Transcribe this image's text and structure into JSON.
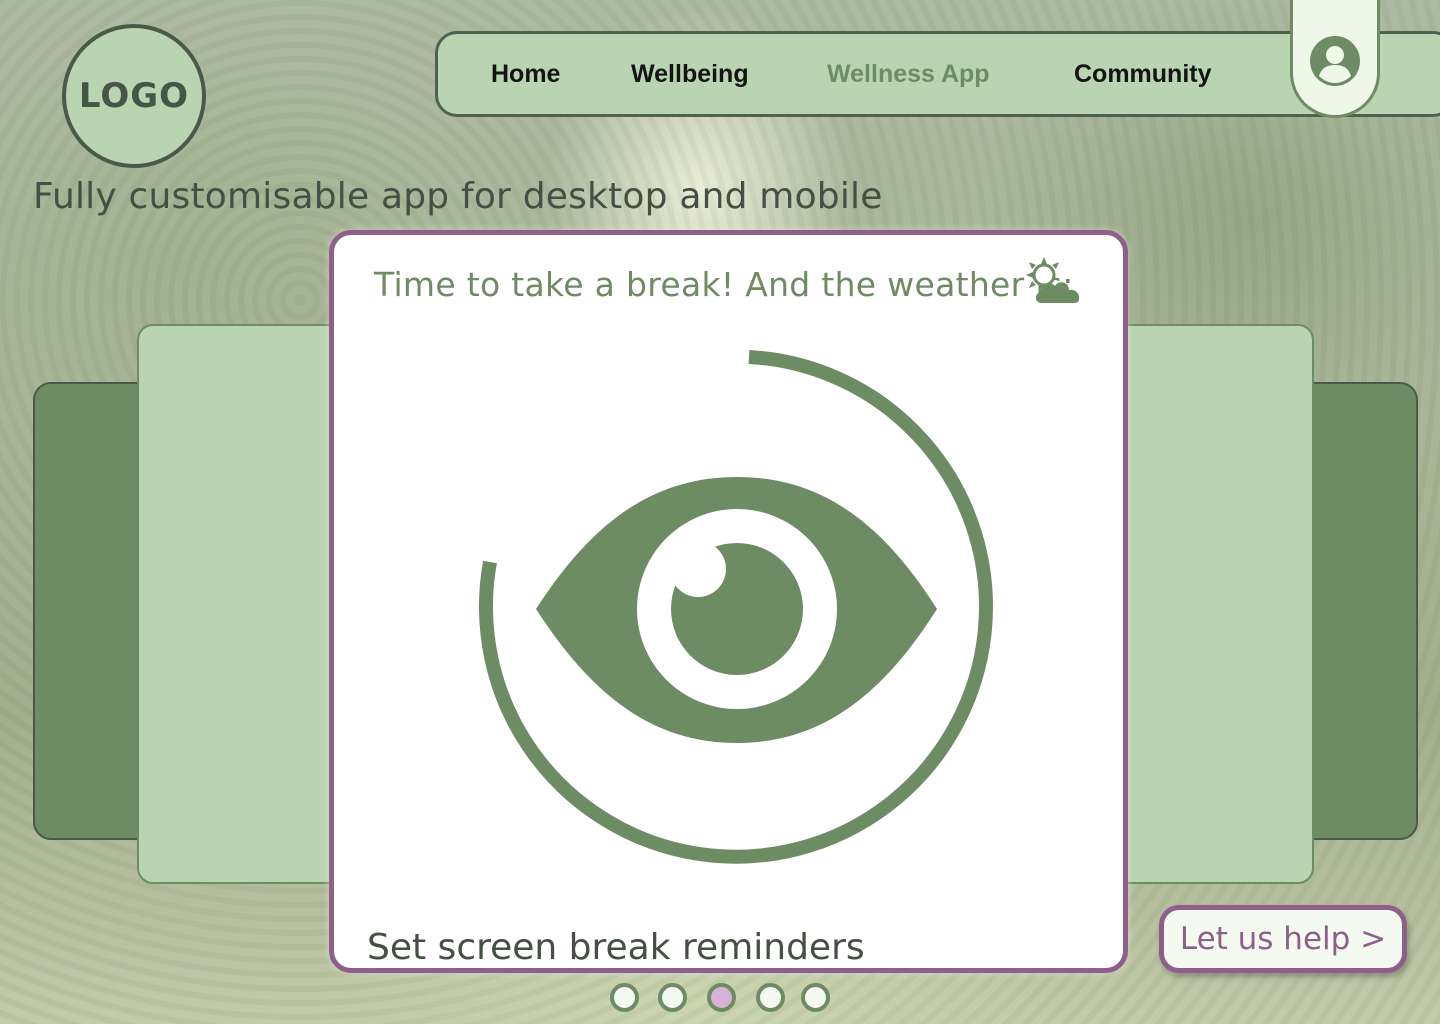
{
  "logo": {
    "text": "LOGO"
  },
  "nav": {
    "items": [
      {
        "label": "Home",
        "active": false
      },
      {
        "label": "Wellbeing",
        "active": false
      },
      {
        "label": "Wellness App",
        "active": true
      },
      {
        "label": "Community",
        "active": false
      }
    ],
    "profile_icon": "user-circle-icon"
  },
  "tagline": "Fully customisable app for desktop and mobile",
  "carousel": {
    "card": {
      "heading": "Time to take a break! And the weather is:",
      "weather_icon": "sun-behind-cloud-icon",
      "graphic_icon": "eye-icon",
      "caption": "Set screen break reminders"
    },
    "pagination": {
      "count": 5,
      "active_index": 2
    }
  },
  "cta": {
    "label": "Let us help >"
  },
  "colors": {
    "primary_green": "#6e8c64",
    "light_green": "#b8d4b0",
    "accent_purple": "#8e5f8b",
    "dot_active": "#d8b2d6"
  }
}
